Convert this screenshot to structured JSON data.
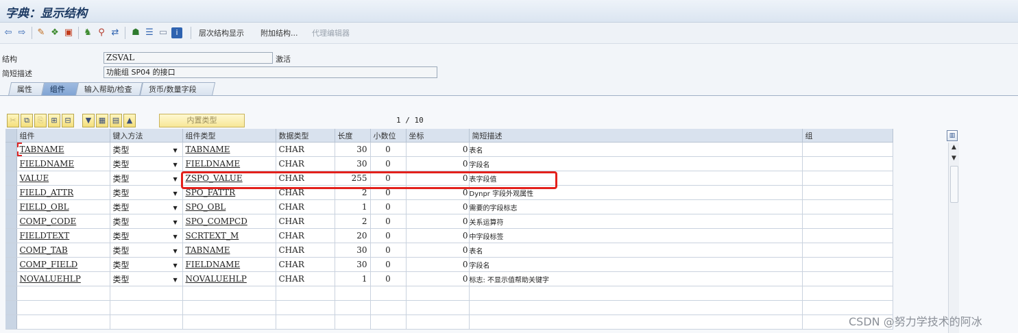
{
  "window": {
    "title": "字典：显示结构"
  },
  "toolbar": {
    "icons": [
      "back-arrow-icon",
      "forward-arrow-icon",
      "display-change-icon",
      "other-object-icon",
      "check-icon",
      "activate-icon",
      "where-used-icon",
      "object-list-icon",
      "hierarchy-icon",
      "technical-settings-icon",
      "display-object-icon",
      "info-icon"
    ],
    "buttons": {
      "hierarchy": "层次结构显示",
      "append": "附加结构...",
      "proxy_editor": "代理编辑器"
    }
  },
  "header": {
    "structure_label": "结构",
    "structure_value": "ZSVAL",
    "status": "激活",
    "desc_label": "简短描述",
    "desc_value": "功能组 SP04 的接口"
  },
  "tabs": [
    "属性",
    "组件",
    "输入帮助/检查",
    "货币/数量字段"
  ],
  "active_tab": "组件",
  "table_toolbar": {
    "builtin_type": "内置类型",
    "page": "1 / 10"
  },
  "table": {
    "columns": [
      "组件",
      "键入方法",
      "组件类型",
      "数据类型",
      "长度",
      "小数位",
      "坐标",
      "简短描述",
      "组"
    ],
    "rows": [
      {
        "component": "TABNAME",
        "method": "类型",
        "type": "TABNAME",
        "datatype": "CHAR",
        "length": "30",
        "decimals": "0",
        "coord": "0",
        "desc": "表名"
      },
      {
        "component": "FIELDNAME",
        "method": "类型",
        "type": "FIELDNAME",
        "datatype": "CHAR",
        "length": "30",
        "decimals": "0",
        "coord": "0",
        "desc": "字段名"
      },
      {
        "component": "VALUE",
        "method": "类型",
        "type": "ZSPO_VALUE",
        "datatype": "CHAR",
        "length": "255",
        "decimals": "0",
        "coord": "0",
        "desc": "表字段值"
      },
      {
        "component": "FIELD_ATTR",
        "method": "类型",
        "type": "SPO_FATTR",
        "datatype": "CHAR",
        "length": "2",
        "decimals": "0",
        "coord": "0",
        "desc": "Dynpr 字段外观属性"
      },
      {
        "component": "FIELD_OBL",
        "method": "类型",
        "type": "SPO_OBL",
        "datatype": "CHAR",
        "length": "1",
        "decimals": "0",
        "coord": "0",
        "desc": "需要的字段标志"
      },
      {
        "component": "COMP_CODE",
        "method": "类型",
        "type": "SPO_COMPCD",
        "datatype": "CHAR",
        "length": "2",
        "decimals": "0",
        "coord": "0",
        "desc": "关系运算符"
      },
      {
        "component": "FIELDTEXT",
        "method": "类型",
        "type": "SCRTEXT_M",
        "datatype": "CHAR",
        "length": "20",
        "decimals": "0",
        "coord": "0",
        "desc": "中字段标签"
      },
      {
        "component": "COMP_TAB",
        "method": "类型",
        "type": "TABNAME",
        "datatype": "CHAR",
        "length": "30",
        "decimals": "0",
        "coord": "0",
        "desc": "表名"
      },
      {
        "component": "COMP_FIELD",
        "method": "类型",
        "type": "FIELDNAME",
        "datatype": "CHAR",
        "length": "30",
        "decimals": "0",
        "coord": "0",
        "desc": "字段名"
      },
      {
        "component": "NOVALUEHLP",
        "method": "类型",
        "type": "NOVALUEHLP",
        "datatype": "CHAR",
        "length": "1",
        "decimals": "0",
        "coord": "0",
        "desc": "标志: 不显示值帮助关键字"
      }
    ]
  },
  "watermark": "CSDN @努力学技术的阿冰",
  "colors": {
    "highlight": "#e3201b",
    "tab_active": "#8fb0da",
    "title": "#1d3a63"
  }
}
